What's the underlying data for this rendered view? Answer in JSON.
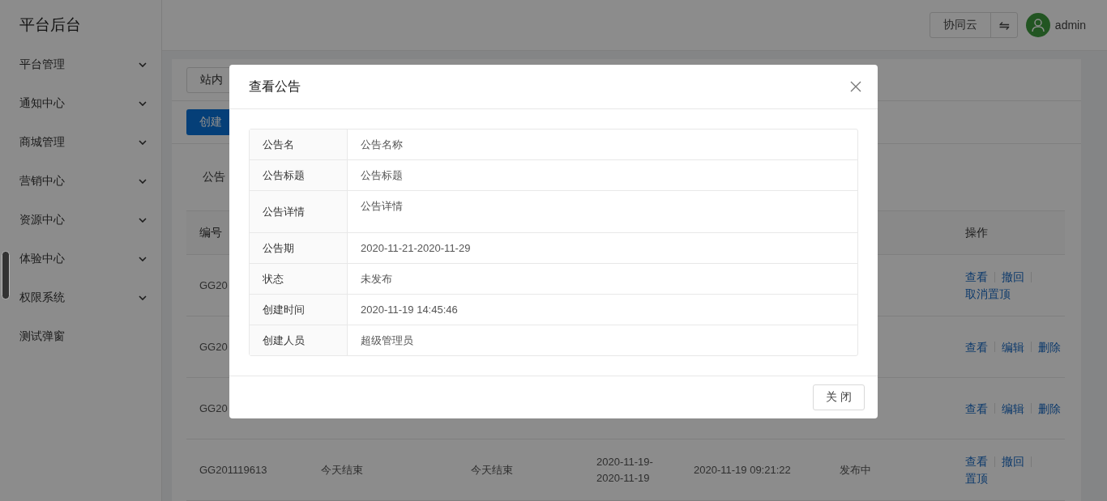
{
  "sidebar": {
    "title": "平台后台",
    "items": [
      {
        "label": "平台管理",
        "expandable": true
      },
      {
        "label": "通知中心",
        "expandable": true
      },
      {
        "label": "商城管理",
        "expandable": true
      },
      {
        "label": "营销中心",
        "expandable": true
      },
      {
        "label": "资源中心",
        "expandable": true
      },
      {
        "label": "体验中心",
        "expandable": true
      },
      {
        "label": "权限系统",
        "expandable": true
      },
      {
        "label": "测试弹窗",
        "expandable": false
      }
    ]
  },
  "header": {
    "org_button": "协同云",
    "switch_button": "⇋",
    "user": "admin"
  },
  "toolbar": {
    "tab": "站内",
    "create_button": "创建"
  },
  "filter": {
    "label": "公告"
  },
  "table": {
    "header": {
      "column_1": "编号",
      "column_7": "操作"
    },
    "rows": [
      {
        "cells": [
          "GG20"
        ],
        "actions": [
          [
            "查看",
            "撤回"
          ],
          [
            "取消置顶"
          ]
        ]
      },
      {
        "cells": [
          "GG20"
        ],
        "actions": [
          [
            "查看",
            "编辑",
            "删除"
          ]
        ]
      },
      {
        "cells": [
          "GG20"
        ],
        "actions": [
          [
            "查看",
            "编辑",
            "删除"
          ]
        ]
      },
      {
        "cells": [
          "GG201119613",
          "今天结束",
          "今天结束",
          "2020-11-19-\n2020-11-19",
          "2020-11-19 09:21:22",
          "发布中"
        ],
        "actions": [
          [
            "查看",
            "撤回"
          ],
          [
            "置顶"
          ]
        ]
      }
    ]
  },
  "modal": {
    "title": "查看公告",
    "fields": [
      {
        "label": "公告名",
        "value": "公告名称",
        "kind": "text"
      },
      {
        "label": "公告标题",
        "value": "公告标题",
        "kind": "text"
      },
      {
        "label": "公告详情",
        "value": "公告详情",
        "kind": "textarea"
      },
      {
        "label": "公告期",
        "value": "2020-11-21-2020-11-29",
        "kind": "text"
      },
      {
        "label": "状态",
        "value": "未发布",
        "kind": "text"
      },
      {
        "label": "创建时间",
        "value": "2020-11-19 14:45:46",
        "kind": "text"
      },
      {
        "label": "创建人员",
        "value": "超级管理员",
        "kind": "text"
      }
    ],
    "close_button": "关 闭"
  }
}
